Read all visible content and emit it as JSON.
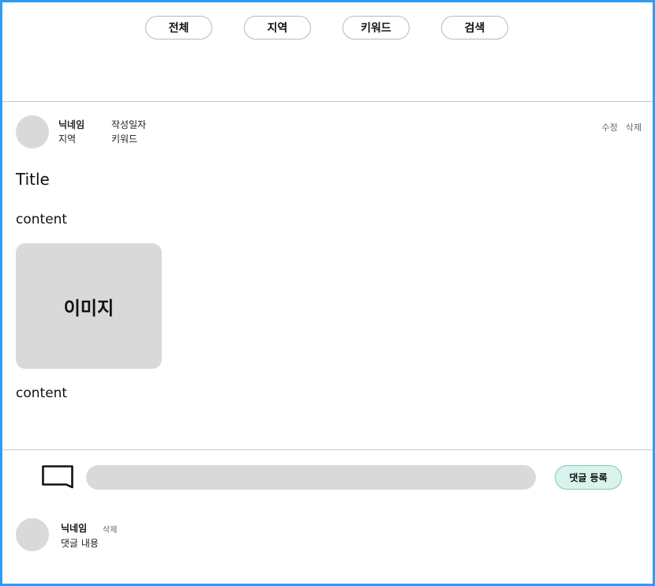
{
  "filters": {
    "items": [
      {
        "label": "전체"
      },
      {
        "label": "지역"
      },
      {
        "label": "키워드"
      },
      {
        "label": "검색"
      }
    ]
  },
  "post": {
    "nickname": "닉네임",
    "date_label": "작성일자",
    "region": "지역",
    "keyword": "키워드",
    "edit_label": "수정",
    "delete_label": "삭제",
    "title": "Title",
    "content_1": "content",
    "image_label": "이미지",
    "content_2": "content"
  },
  "comment_form": {
    "input_value": "",
    "submit_label": "댓글 등록"
  },
  "comments": [
    {
      "nickname": "닉네임",
      "delete_label": "삭제",
      "text": "댓글 내용"
    }
  ],
  "colors": {
    "frame_border": "#2f9bf4",
    "placeholder_gray": "#d9d9d9",
    "submit_bg": "#d7f3ec",
    "submit_border": "#7fc8b8"
  },
  "icons": [
    "speech-bubble-icon"
  ]
}
